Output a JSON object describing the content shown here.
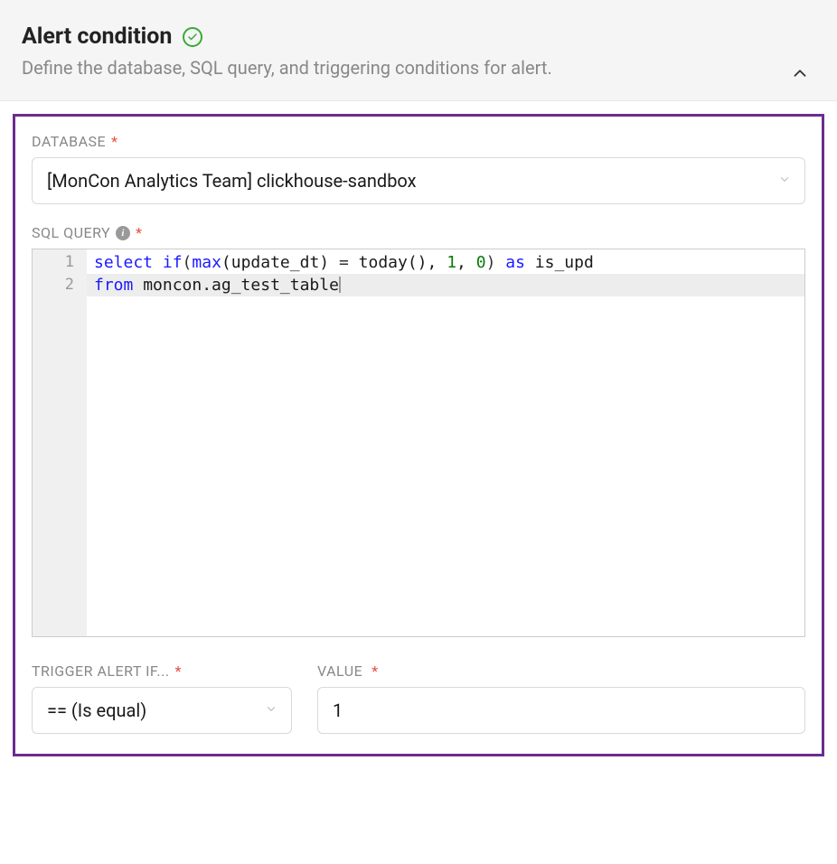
{
  "header": {
    "title": "Alert condition",
    "subtitle": "Define the database, SQL query, and triggering conditions for alert."
  },
  "fields": {
    "database_label": "DATABASE",
    "database_value": "[MonCon Analytics Team] clickhouse-sandbox",
    "sql_label": "SQL QUERY",
    "sql_lines": [
      {
        "n": "1",
        "tokens": [
          {
            "t": "select ",
            "c": "kw"
          },
          {
            "t": "if",
            "c": "fn"
          },
          {
            "t": "(",
            "c": "paren"
          },
          {
            "t": "max",
            "c": "fn"
          },
          {
            "t": "(update_dt) ",
            "c": ""
          },
          {
            "t": "= ",
            "c": "op"
          },
          {
            "t": "today(), ",
            "c": ""
          },
          {
            "t": "1",
            "c": "num"
          },
          {
            "t": ", ",
            "c": ""
          },
          {
            "t": "0",
            "c": "num"
          },
          {
            "t": ") ",
            "c": "paren"
          },
          {
            "t": "as ",
            "c": "as-kw"
          },
          {
            "t": "is_upd",
            "c": ""
          }
        ],
        "active": false
      },
      {
        "n": "2",
        "tokens": [
          {
            "t": "from ",
            "c": "kw"
          },
          {
            "t": "moncon.ag_test_table",
            "c": ""
          }
        ],
        "active": true
      }
    ],
    "trigger_label": "TRIGGER ALERT IF...",
    "trigger_value": "== (Is equal)",
    "value_label": "VALUE",
    "value_value": "1",
    "required": "*"
  }
}
